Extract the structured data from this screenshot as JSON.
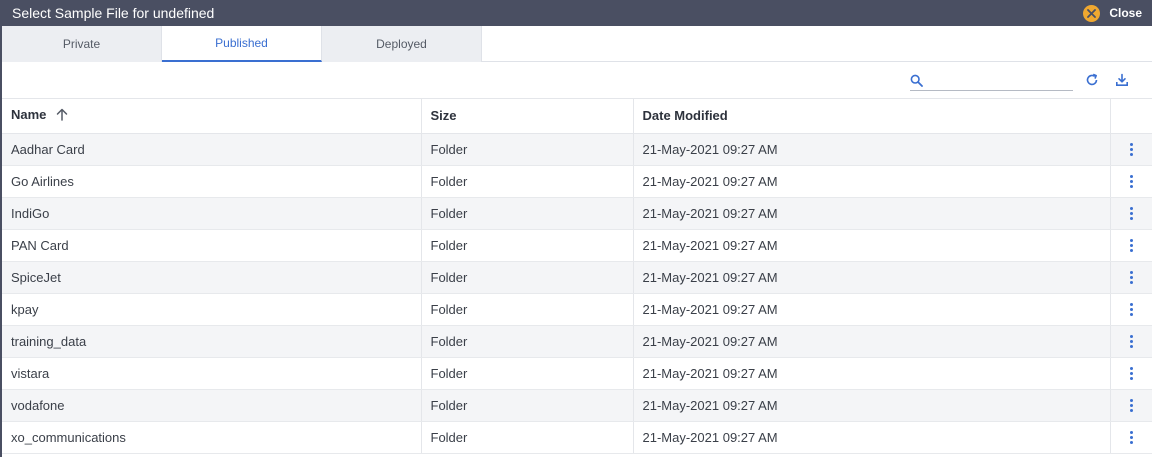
{
  "dialog": {
    "title": "Select Sample File for undefined",
    "close_label": "Close"
  },
  "tabs": [
    {
      "label": "Private",
      "active": false
    },
    {
      "label": "Published",
      "active": true
    },
    {
      "label": "Deployed",
      "active": false
    }
  ],
  "search": {
    "placeholder": "",
    "value": ""
  },
  "icons": {
    "search": "search-icon",
    "refresh": "refresh-icon",
    "download": "download-icon",
    "sort": "arrow-up-icon",
    "row_menu": "more-vertical-icon",
    "close": "close-icon"
  },
  "colors": {
    "titlebar": "#4a4f62",
    "accent": "#3a6fd1",
    "close_badge": "#f0a830"
  },
  "table": {
    "columns": {
      "name": "Name",
      "size": "Size",
      "date": "Date Modified"
    },
    "sort": {
      "column": "Name",
      "direction": "ascending"
    },
    "rows": [
      {
        "name": "Aadhar Card",
        "size": "Folder",
        "date": "21-May-2021 09:27 AM"
      },
      {
        "name": "Go Airlines",
        "size": "Folder",
        "date": "21-May-2021 09:27 AM"
      },
      {
        "name": "IndiGo",
        "size": "Folder",
        "date": "21-May-2021 09:27 AM"
      },
      {
        "name": "PAN Card",
        "size": "Folder",
        "date": "21-May-2021 09:27 AM"
      },
      {
        "name": "SpiceJet",
        "size": "Folder",
        "date": "21-May-2021 09:27 AM"
      },
      {
        "name": "kpay",
        "size": "Folder",
        "date": "21-May-2021 09:27 AM"
      },
      {
        "name": "training_data",
        "size": "Folder",
        "date": "21-May-2021 09:27 AM"
      },
      {
        "name": "vistara",
        "size": "Folder",
        "date": "21-May-2021 09:27 AM"
      },
      {
        "name": "vodafone",
        "size": "Folder",
        "date": "21-May-2021 09:27 AM"
      },
      {
        "name": "xo_communications",
        "size": "Folder",
        "date": "21-May-2021 09:27 AM"
      }
    ]
  }
}
